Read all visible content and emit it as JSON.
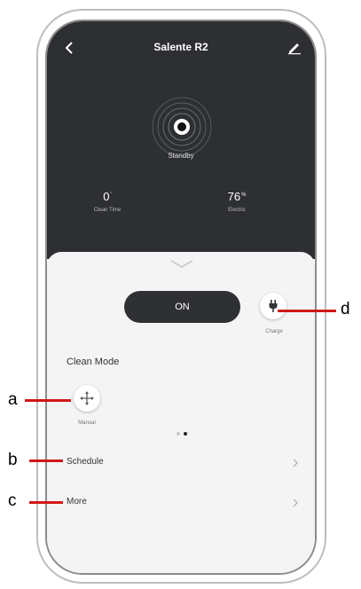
{
  "header": {
    "title": "Salente R2"
  },
  "status": {
    "label": "Standby"
  },
  "stats": [
    {
      "value": "0",
      "unit": "'",
      "label": "Clean Time"
    },
    {
      "value": "76",
      "unit": "%",
      "label": "Electric"
    }
  ],
  "controls": {
    "power_label": "ON",
    "charge_label": "Charge"
  },
  "clean_mode": {
    "title": "Clean Mode",
    "manual_label": "Manual"
  },
  "menu": {
    "schedule": "Schedule",
    "more": "More"
  },
  "callouts": {
    "a": "a",
    "b": "b",
    "c": "c",
    "d": "d"
  },
  "colors": {
    "dark_panel": "#2d2f33",
    "light_panel": "#f4f4f5",
    "callout": "#d01818"
  }
}
